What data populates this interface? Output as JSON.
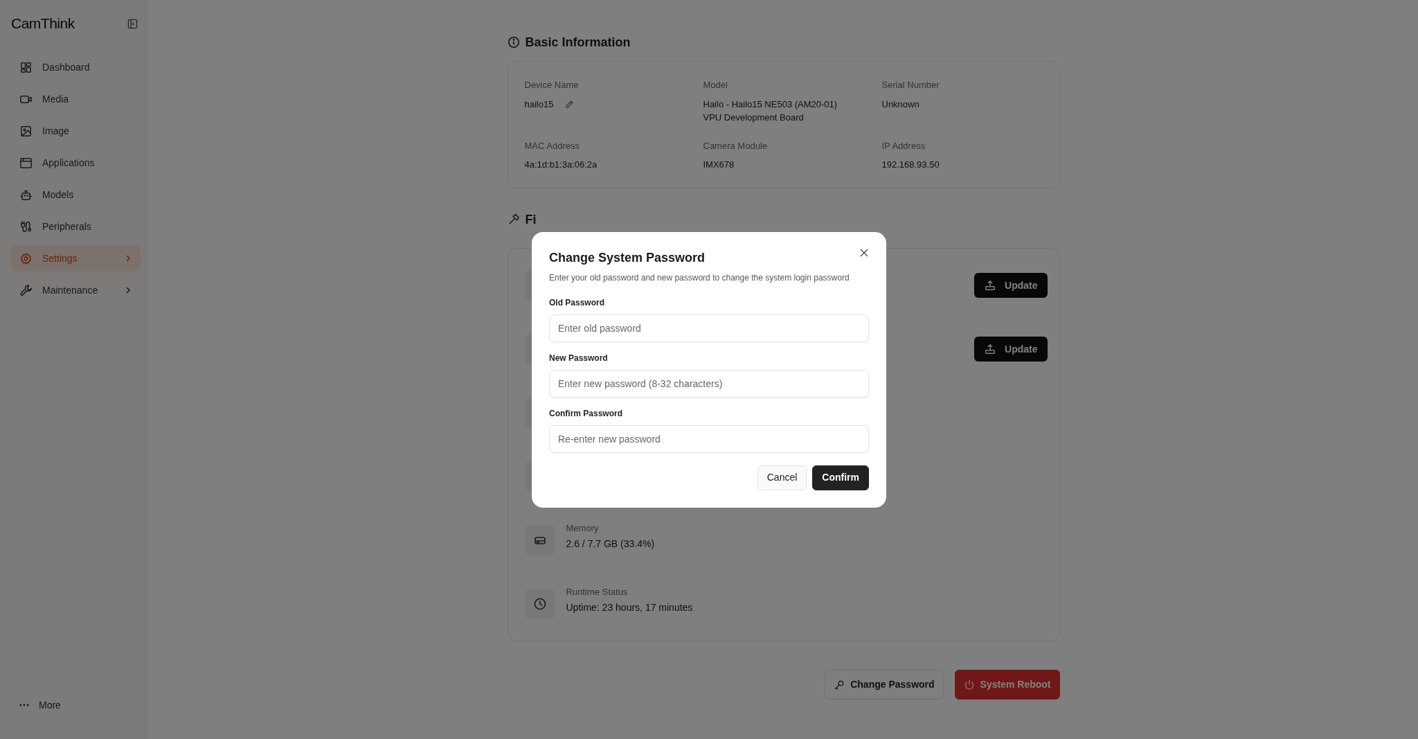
{
  "sidebar": {
    "logo": "CamThink",
    "items": [
      {
        "label": "Dashboard",
        "selected": false,
        "expandable": false
      },
      {
        "label": "Media",
        "selected": false,
        "expandable": false
      },
      {
        "label": "Image",
        "selected": false,
        "expandable": false
      },
      {
        "label": "Applications",
        "selected": false,
        "expandable": false
      },
      {
        "label": "Models",
        "selected": false,
        "expandable": false
      },
      {
        "label": "Peripherals",
        "selected": false,
        "expandable": false
      },
      {
        "label": "Settings",
        "selected": true,
        "expandable": true
      },
      {
        "label": "Maintenance",
        "selected": false,
        "expandable": true
      }
    ],
    "more": "More"
  },
  "basic_info": {
    "title": "Basic Information",
    "fields": [
      {
        "label": "Device Name",
        "value": "hailo15",
        "editable": true
      },
      {
        "label": "Model",
        "value": "Hailo - Hailo15 NE503 (AM20-01) VPU Development Board",
        "editable": false
      },
      {
        "label": "Serial Number",
        "value": "Unknown",
        "editable": false
      },
      {
        "label": "MAC Address",
        "value": "4a:1d:b1:3a:06:2a",
        "editable": false
      },
      {
        "label": "Camera Module",
        "value": "IMX678",
        "editable": false
      },
      {
        "label": "IP Address",
        "value": "192.168.93.50",
        "editable": false
      }
    ]
  },
  "firmware_hardware": {
    "title": "Fi",
    "rows": [
      {
        "kind": "action",
        "button": "Update"
      },
      {
        "kind": "action",
        "button": "Update"
      },
      {
        "kind": "blank"
      },
      {
        "kind": "blank"
      },
      {
        "kind": "info",
        "label": "Memory",
        "value": "2.6 / 7.7 GB (33.4%)"
      },
      {
        "kind": "info",
        "label": "Runtime Status",
        "value": "Uptime: 23 hours, 17 minutes"
      }
    ]
  },
  "actions": [
    {
      "kind": "secondary",
      "label": "Change Password"
    },
    {
      "kind": "danger",
      "label": "System Reboot"
    }
  ],
  "dialog": {
    "title": "Change System Password",
    "description": "Enter your old password and new password to change the system login password",
    "fields": [
      {
        "label": "Old Password",
        "placeholder": "Enter old password"
      },
      {
        "label": "New Password",
        "placeholder": "Enter new password (8-32 characters)"
      },
      {
        "label": "Confirm Password",
        "placeholder": "Re-enter new password"
      }
    ],
    "buttons": [
      {
        "kind": "secondary",
        "label": "Cancel"
      },
      {
        "kind": "primary",
        "label": "Confirm"
      }
    ]
  }
}
